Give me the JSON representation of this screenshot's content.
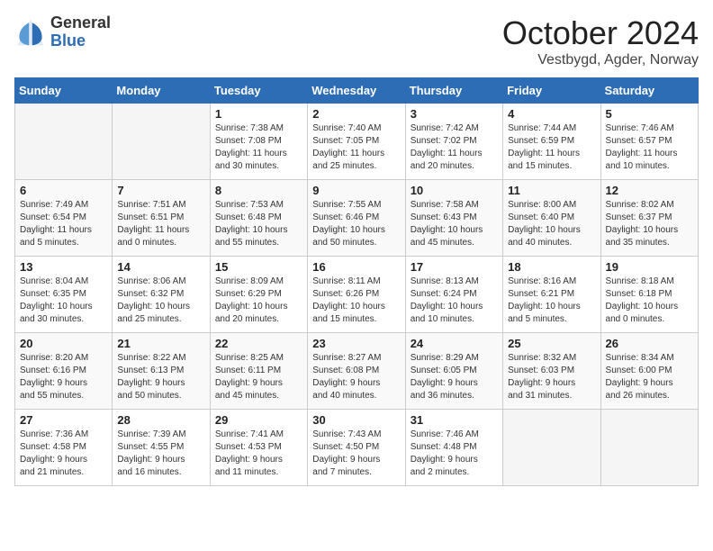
{
  "header": {
    "logo_line1": "General",
    "logo_line2": "Blue",
    "month": "October 2024",
    "location": "Vestbygd, Agder, Norway"
  },
  "weekdays": [
    "Sunday",
    "Monday",
    "Tuesday",
    "Wednesday",
    "Thursday",
    "Friday",
    "Saturday"
  ],
  "weeks": [
    [
      {
        "day": "",
        "info": ""
      },
      {
        "day": "",
        "info": ""
      },
      {
        "day": "1",
        "info": "Sunrise: 7:38 AM\nSunset: 7:08 PM\nDaylight: 11 hours\nand 30 minutes."
      },
      {
        "day": "2",
        "info": "Sunrise: 7:40 AM\nSunset: 7:05 PM\nDaylight: 11 hours\nand 25 minutes."
      },
      {
        "day": "3",
        "info": "Sunrise: 7:42 AM\nSunset: 7:02 PM\nDaylight: 11 hours\nand 20 minutes."
      },
      {
        "day": "4",
        "info": "Sunrise: 7:44 AM\nSunset: 6:59 PM\nDaylight: 11 hours\nand 15 minutes."
      },
      {
        "day": "5",
        "info": "Sunrise: 7:46 AM\nSunset: 6:57 PM\nDaylight: 11 hours\nand 10 minutes."
      }
    ],
    [
      {
        "day": "6",
        "info": "Sunrise: 7:49 AM\nSunset: 6:54 PM\nDaylight: 11 hours\nand 5 minutes."
      },
      {
        "day": "7",
        "info": "Sunrise: 7:51 AM\nSunset: 6:51 PM\nDaylight: 11 hours\nand 0 minutes."
      },
      {
        "day": "8",
        "info": "Sunrise: 7:53 AM\nSunset: 6:48 PM\nDaylight: 10 hours\nand 55 minutes."
      },
      {
        "day": "9",
        "info": "Sunrise: 7:55 AM\nSunset: 6:46 PM\nDaylight: 10 hours\nand 50 minutes."
      },
      {
        "day": "10",
        "info": "Sunrise: 7:58 AM\nSunset: 6:43 PM\nDaylight: 10 hours\nand 45 minutes."
      },
      {
        "day": "11",
        "info": "Sunrise: 8:00 AM\nSunset: 6:40 PM\nDaylight: 10 hours\nand 40 minutes."
      },
      {
        "day": "12",
        "info": "Sunrise: 8:02 AM\nSunset: 6:37 PM\nDaylight: 10 hours\nand 35 minutes."
      }
    ],
    [
      {
        "day": "13",
        "info": "Sunrise: 8:04 AM\nSunset: 6:35 PM\nDaylight: 10 hours\nand 30 minutes."
      },
      {
        "day": "14",
        "info": "Sunrise: 8:06 AM\nSunset: 6:32 PM\nDaylight: 10 hours\nand 25 minutes."
      },
      {
        "day": "15",
        "info": "Sunrise: 8:09 AM\nSunset: 6:29 PM\nDaylight: 10 hours\nand 20 minutes."
      },
      {
        "day": "16",
        "info": "Sunrise: 8:11 AM\nSunset: 6:26 PM\nDaylight: 10 hours\nand 15 minutes."
      },
      {
        "day": "17",
        "info": "Sunrise: 8:13 AM\nSunset: 6:24 PM\nDaylight: 10 hours\nand 10 minutes."
      },
      {
        "day": "18",
        "info": "Sunrise: 8:16 AM\nSunset: 6:21 PM\nDaylight: 10 hours\nand 5 minutes."
      },
      {
        "day": "19",
        "info": "Sunrise: 8:18 AM\nSunset: 6:18 PM\nDaylight: 10 hours\nand 0 minutes."
      }
    ],
    [
      {
        "day": "20",
        "info": "Sunrise: 8:20 AM\nSunset: 6:16 PM\nDaylight: 9 hours\nand 55 minutes."
      },
      {
        "day": "21",
        "info": "Sunrise: 8:22 AM\nSunset: 6:13 PM\nDaylight: 9 hours\nand 50 minutes."
      },
      {
        "day": "22",
        "info": "Sunrise: 8:25 AM\nSunset: 6:11 PM\nDaylight: 9 hours\nand 45 minutes."
      },
      {
        "day": "23",
        "info": "Sunrise: 8:27 AM\nSunset: 6:08 PM\nDaylight: 9 hours\nand 40 minutes."
      },
      {
        "day": "24",
        "info": "Sunrise: 8:29 AM\nSunset: 6:05 PM\nDaylight: 9 hours\nand 36 minutes."
      },
      {
        "day": "25",
        "info": "Sunrise: 8:32 AM\nSunset: 6:03 PM\nDaylight: 9 hours\nand 31 minutes."
      },
      {
        "day": "26",
        "info": "Sunrise: 8:34 AM\nSunset: 6:00 PM\nDaylight: 9 hours\nand 26 minutes."
      }
    ],
    [
      {
        "day": "27",
        "info": "Sunrise: 7:36 AM\nSunset: 4:58 PM\nDaylight: 9 hours\nand 21 minutes."
      },
      {
        "day": "28",
        "info": "Sunrise: 7:39 AM\nSunset: 4:55 PM\nDaylight: 9 hours\nand 16 minutes."
      },
      {
        "day": "29",
        "info": "Sunrise: 7:41 AM\nSunset: 4:53 PM\nDaylight: 9 hours\nand 11 minutes."
      },
      {
        "day": "30",
        "info": "Sunrise: 7:43 AM\nSunset: 4:50 PM\nDaylight: 9 hours\nand 7 minutes."
      },
      {
        "day": "31",
        "info": "Sunrise: 7:46 AM\nSunset: 4:48 PM\nDaylight: 9 hours\nand 2 minutes."
      },
      {
        "day": "",
        "info": ""
      },
      {
        "day": "",
        "info": ""
      }
    ]
  ]
}
